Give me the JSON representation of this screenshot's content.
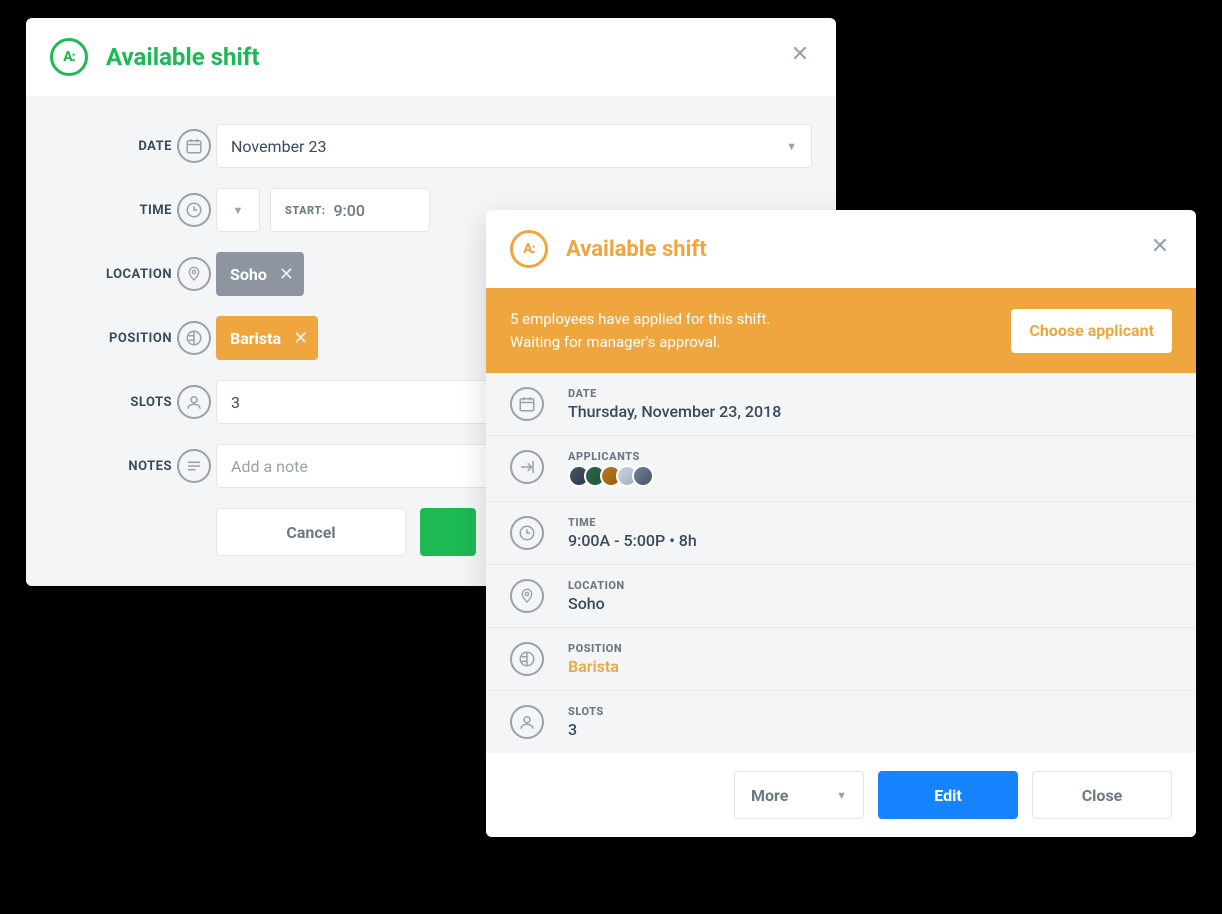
{
  "modal1": {
    "title": "Available shift",
    "fields": {
      "date_label": "DATE",
      "date_value": "November 23",
      "time_label": "TIME",
      "time_start_label": "START:",
      "time_start_value": "9:00",
      "location_label": "LOCATION",
      "location_value": "Soho",
      "position_label": "POSITION",
      "position_value": "Barista",
      "slots_label": "SLOTS",
      "slots_value": "3",
      "notes_label": "NOTES",
      "notes_placeholder": "Add a note"
    },
    "buttons": {
      "cancel": "Cancel"
    }
  },
  "modal2": {
    "title": "Available shift",
    "banner": {
      "line1": "5 employees have applied for this shift.",
      "line2": "Waiting for manager's approval.",
      "cta": "Choose applicant"
    },
    "details": {
      "date_label": "DATE",
      "date_value": "Thursday, November 23, 2018",
      "applicants_label": "APPLICANTS",
      "applicants_count": 5,
      "time_label": "TIME",
      "time_value": "9:00A - 5:00P • 8h",
      "location_label": "LOCATION",
      "location_value": "Soho",
      "position_label": "POSITION",
      "position_value": "Barista",
      "slots_label": "SLOTS",
      "slots_value": "3"
    },
    "buttons": {
      "more": "More",
      "edit": "Edit",
      "close": "Close"
    }
  }
}
